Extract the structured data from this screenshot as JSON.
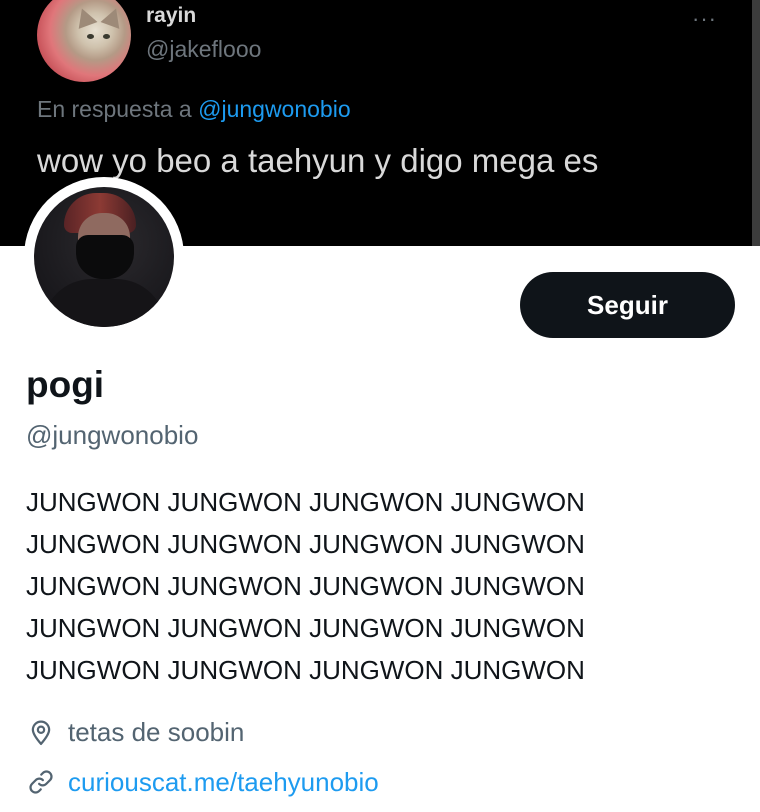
{
  "banner_tweet": {
    "name": "rayin",
    "handle": "@jakeflooo",
    "more": "···",
    "reply_prefix": "En respuesta a",
    "reply_mention": "@jungwonobio",
    "text": "wow yo beo a taehyun y digo mega es"
  },
  "profile": {
    "display_name": "pogi",
    "username": "@jungwonobio",
    "follow_label": "Seguir",
    "bio_lines": [
      "JUNGWON JUNGWON JUNGWON JUNGWON",
      "JUNGWON JUNGWON JUNGWON JUNGWON",
      "JUNGWON JUNGWON JUNGWON JUNGWON",
      "JUNGWON JUNGWON JUNGWON JUNGWON",
      "JUNGWON JUNGWON JUNGWON JUNGWON"
    ],
    "location": "tetas de soobin",
    "link": "curiouscat.me/taehyunobio"
  },
  "icons": {
    "location": "location-pin-icon",
    "link": "link-icon"
  },
  "colors": {
    "accent": "#1d9bf0",
    "text_primary": "#0f1419",
    "text_secondary": "#536471",
    "button_bg": "#0f1419",
    "banner_bg": "#000000"
  }
}
